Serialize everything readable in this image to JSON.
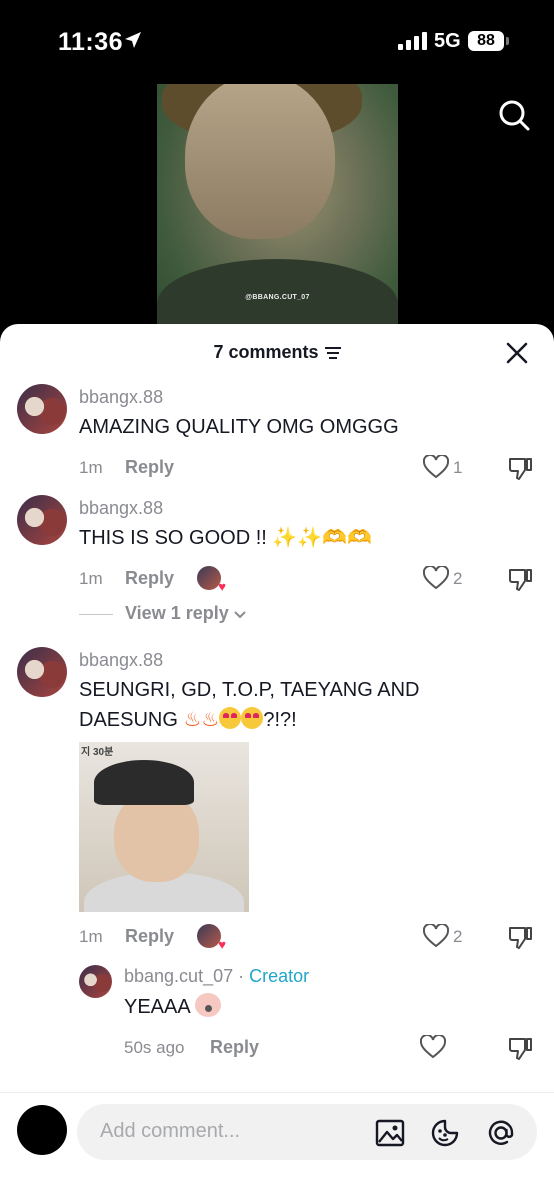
{
  "status_bar": {
    "time": "11:36",
    "network": "5G",
    "battery": "88"
  },
  "video": {
    "watermark": "@BBANG.CUT_07"
  },
  "comments_header": {
    "count_label": "7 comments"
  },
  "comments": [
    {
      "username": "bbangx.88",
      "text": "AMAZING QUALITY OMG OMGGG",
      "time": "1m",
      "reply_label": "Reply",
      "likes": "1"
    },
    {
      "username": "bbangx.88",
      "text": "THIS IS SO GOOD !!",
      "emojis": "✨✨🫶🫶",
      "time": "1m",
      "reply_label": "Reply",
      "likes": "2",
      "view_replies": "View 1 reply"
    },
    {
      "username": "bbangx.88",
      "text_line1": "SEUNGRI, GD, T.O.P, TAEYANG AND",
      "text_line2_start": "DAESUNG",
      "text_line2_end": "?!?!",
      "image_text": "지 30분",
      "time": "1m",
      "reply_label": "Reply",
      "likes": "2"
    }
  ],
  "reply": {
    "username": "bbang.cut_07",
    "separator": " · ",
    "creator_label": "Creator",
    "text": "YEAAA",
    "time": "50s ago",
    "reply_label": "Reply"
  },
  "input": {
    "placeholder": "Add comment..."
  },
  "icons": {
    "search": "search-icon",
    "close": "close-icon",
    "filter": "filter-icon",
    "heart": "heart-icon",
    "dislike": "dislike-icon",
    "image": "image-icon",
    "emoji": "emoji-icon",
    "mention": "at-icon"
  },
  "colors": {
    "creator_accent": "#20a6c9",
    "like_heart": "#fe2c55",
    "text": "#161823",
    "muted": "#8a8b91"
  }
}
